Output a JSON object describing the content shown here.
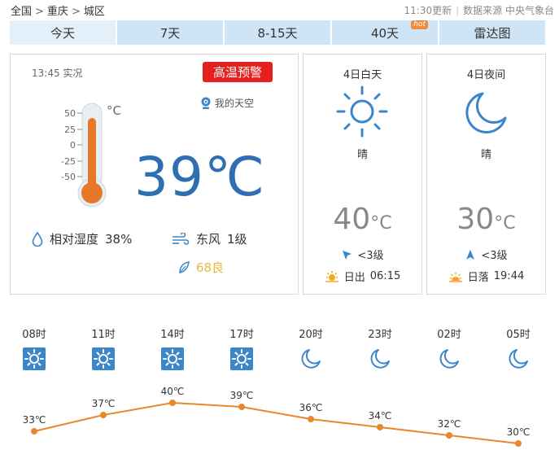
{
  "breadcrumb": {
    "country": "全国",
    "province": "重庆",
    "district": "城区",
    "sep": ">"
  },
  "header": {
    "update": "11:30更新",
    "source_label": "数据来源",
    "source": "中央气象台"
  },
  "tabs": [
    {
      "label": "今天",
      "active": true
    },
    {
      "label": "7天"
    },
    {
      "label": "8-15天"
    },
    {
      "label": "40天",
      "badge": "hot"
    },
    {
      "label": "雷达图"
    }
  ],
  "current": {
    "time": "13:45 实况",
    "warning": "高温预警",
    "my_sky": "我的天空",
    "temperature": "39℃",
    "thermo_unit": "°C",
    "thermo_ticks": [
      "50",
      "25",
      "0",
      "-25",
      "-50"
    ],
    "humidity_label": "相对湿度",
    "humidity": "38%",
    "wind_dir": "东风",
    "wind_level": "1级",
    "aqi": "68良"
  },
  "day": {
    "title": "4日白天",
    "condition": "晴",
    "temp": "40",
    "unit": "°C",
    "wind": "<3级",
    "sun_label": "日出",
    "sun_time": "06:15"
  },
  "night": {
    "title": "4日夜间",
    "condition": "晴",
    "temp": "30",
    "unit": "°C",
    "wind": "<3级",
    "sun_label": "日落",
    "sun_time": "19:44"
  },
  "chart_data": {
    "type": "line",
    "categories": [
      "08时",
      "11时",
      "14时",
      "17时",
      "20时",
      "23时",
      "02时",
      "05时"
    ],
    "values": [
      33,
      37,
      40,
      39,
      36,
      34,
      32,
      30
    ],
    "labels": [
      "33℃",
      "37℃",
      "40℃",
      "39℃",
      "36℃",
      "34℃",
      "32℃",
      "30℃"
    ],
    "icons": [
      "sun-icon",
      "sun-icon",
      "sun-icon",
      "sun-icon",
      "moon-icon",
      "moon-icon",
      "moon-icon",
      "moon-icon"
    ],
    "line_color": "#e8882c"
  },
  "colors": {
    "accent": "#2e6fb4",
    "warning": "#e52020",
    "tab": "#cfe4f5",
    "aqi": "#e9b93c"
  }
}
